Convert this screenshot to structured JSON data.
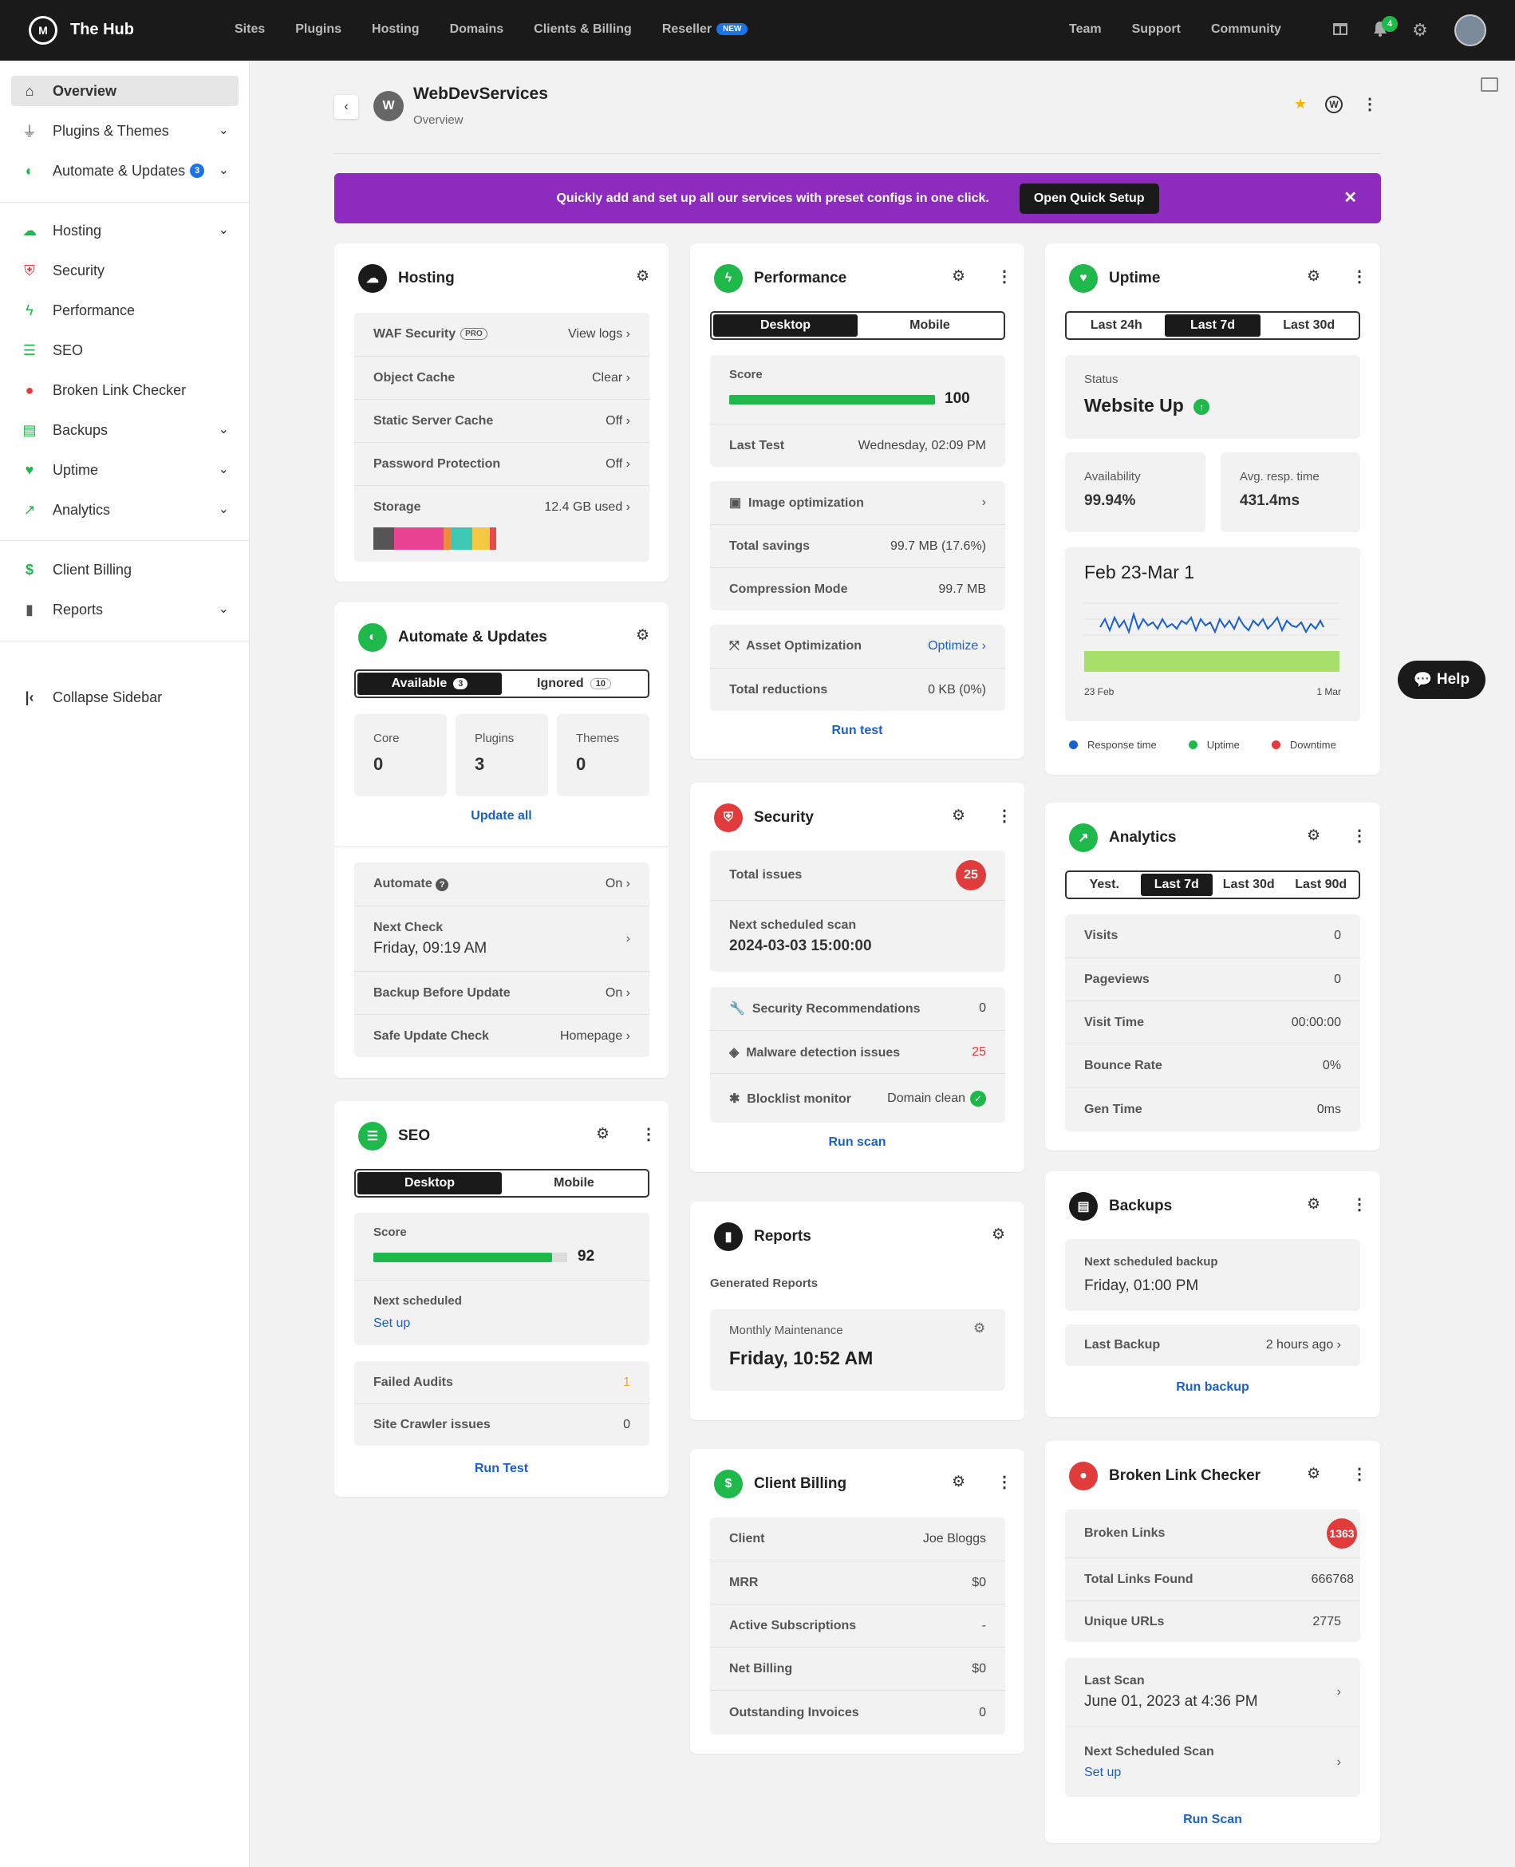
{
  "app": {
    "brand": "The Hub",
    "logo": "wpmu-logo"
  },
  "topnav": {
    "items": [
      "Sites",
      "Plugins",
      "Hosting",
      "Domains",
      "Clients & Billing",
      "Reseller"
    ],
    "new_badge": "NEW",
    "right": [
      "Team",
      "Support",
      "Community"
    ],
    "notif_count": "4"
  },
  "sidebar": {
    "overview": "Overview",
    "plugins_themes": "Plugins & Themes",
    "automate": "Automate & Updates",
    "automate_count": "3",
    "hosting": "Hosting",
    "security": "Security",
    "performance": "Performance",
    "seo": "SEO",
    "blc": "Broken Link Checker",
    "backups": "Backups",
    "uptime": "Uptime",
    "analytics": "Analytics",
    "client_billing": "Client Billing",
    "reports": "Reports",
    "collapse": "Collapse Sidebar"
  },
  "site": {
    "avatar": "W",
    "name": "WebDevServices",
    "sub": "Overview"
  },
  "banner": {
    "text": "Quickly add and set up all our services with preset configs in one click.",
    "button": "Open Quick Setup"
  },
  "hosting": {
    "title": "Hosting",
    "waf": "WAF Security",
    "waf_tag": "PRO",
    "waf_val": "View logs",
    "cache": "Object Cache",
    "cache_val": "Clear",
    "static": "Static Server Cache",
    "static_val": "Off",
    "pwd": "Password Protection",
    "pwd_val": "Off",
    "storage": "Storage",
    "storage_val": "12.4 GB used"
  },
  "automate": {
    "title": "Automate & Updates",
    "available": "Available",
    "available_count": "3",
    "ignored": "Ignored",
    "ignored_count": "10",
    "core": "Core",
    "core_val": "0",
    "plugins": "Plugins",
    "plugins_val": "3",
    "themes": "Themes",
    "themes_val": "0",
    "update_all": "Update all",
    "automate": "Automate",
    "automate_val": "On",
    "next_check": "Next Check",
    "next_check_val": "Friday, 09:19 AM",
    "backup_before": "Backup Before Update",
    "backup_before_val": "On",
    "safe_check": "Safe Update Check",
    "safe_check_val": "Homepage"
  },
  "seo": {
    "title": "SEO",
    "desktop": "Desktop",
    "mobile": "Mobile",
    "score": "Score",
    "score_val": "92",
    "score_pct": 0.92,
    "next": "Next scheduled",
    "setup": "Set up",
    "failed": "Failed Audits",
    "failed_val": "1",
    "crawler": "Site Crawler issues",
    "crawler_val": "0",
    "run": "Run Test"
  },
  "performance": {
    "title": "Performance",
    "desktop": "Desktop",
    "mobile": "Mobile",
    "score": "Score",
    "score_val": "100",
    "score_pct": 1.0,
    "last_test": "Last Test",
    "last_test_val": "Wednesday, 02:09 PM",
    "image_opt": "Image optimization",
    "savings": "Total savings",
    "savings_val": "99.7 MB (17.6%)",
    "compression": "Compression Mode",
    "compression_val": "99.7 MB",
    "asset_opt": "Asset Optimization",
    "optimize": "Optimize",
    "reductions": "Total reductions",
    "reductions_val": "0 KB (0%)",
    "run": "Run test"
  },
  "security": {
    "title": "Security",
    "total": "Total issues",
    "total_val": "25",
    "next_scan": "Next scheduled scan",
    "next_scan_val": "2024-03-03 15:00:00",
    "recs": "Security Recommendations",
    "recs_val": "0",
    "malware": "Malware detection issues",
    "malware_val": "25",
    "blocklist": "Blocklist monitor",
    "blocklist_val": "Domain clean",
    "run": "Run scan"
  },
  "reports": {
    "title": "Reports",
    "generated": "Generated Reports",
    "monthly": "Monthly Maintenance",
    "monthly_val": "Friday, 10:52 AM"
  },
  "billing": {
    "title": "Client Billing",
    "client": "Client",
    "client_val": "Joe Bloggs",
    "mrr": "MRR",
    "mrr_val": "$0",
    "subs": "Active Subscriptions",
    "subs_val": "-",
    "net": "Net Billing",
    "net_val": "$0",
    "invoices": "Outstanding Invoices",
    "invoices_val": "0"
  },
  "uptime": {
    "title": "Uptime",
    "tabs": [
      "Last 24h",
      "Last 7d",
      "Last 30d"
    ],
    "status": "Status",
    "status_val": "Website Up",
    "availability": "Availability",
    "availability_val": "99.94%",
    "resp": "Avg. resp. time",
    "resp_val": "431.4ms",
    "range": "Feb 23-Mar 1",
    "start": "23 Feb",
    "end": "1 Mar",
    "legend": [
      "Response time",
      "Uptime",
      "Downtime"
    ]
  },
  "analytics": {
    "title": "Analytics",
    "tabs": [
      "Yest.",
      "Last 7d",
      "Last 30d",
      "Last 90d"
    ],
    "rows": [
      [
        "Visits",
        "0"
      ],
      [
        "Pageviews",
        "0"
      ],
      [
        "Visit Time",
        "00:00:00"
      ],
      [
        "Bounce Rate",
        "0%"
      ],
      [
        "Gen Time",
        "0ms"
      ]
    ]
  },
  "backups": {
    "title": "Backups",
    "next": "Next scheduled backup",
    "next_val": "Friday, 01:00 PM",
    "last": "Last Backup",
    "last_val": "2 hours ago",
    "run": "Run backup"
  },
  "blc": {
    "title": "Broken Link Checker",
    "broken": "Broken Links",
    "broken_val": "1363",
    "total": "Total Links Found",
    "total_val": "666768",
    "unique": "Unique URLs",
    "unique_val": "2775",
    "last_scan": "Last Scan",
    "last_scan_val": "June 01, 2023 at 4:36 PM",
    "next_scan": "Next Scheduled Scan",
    "setup": "Set up",
    "run": "Run Scan"
  },
  "help": "Help",
  "colors": {
    "accent": "#1a5fd0",
    "green": "#1fb84b",
    "red": "#e03c3c",
    "purple": "#8d2bbf"
  }
}
